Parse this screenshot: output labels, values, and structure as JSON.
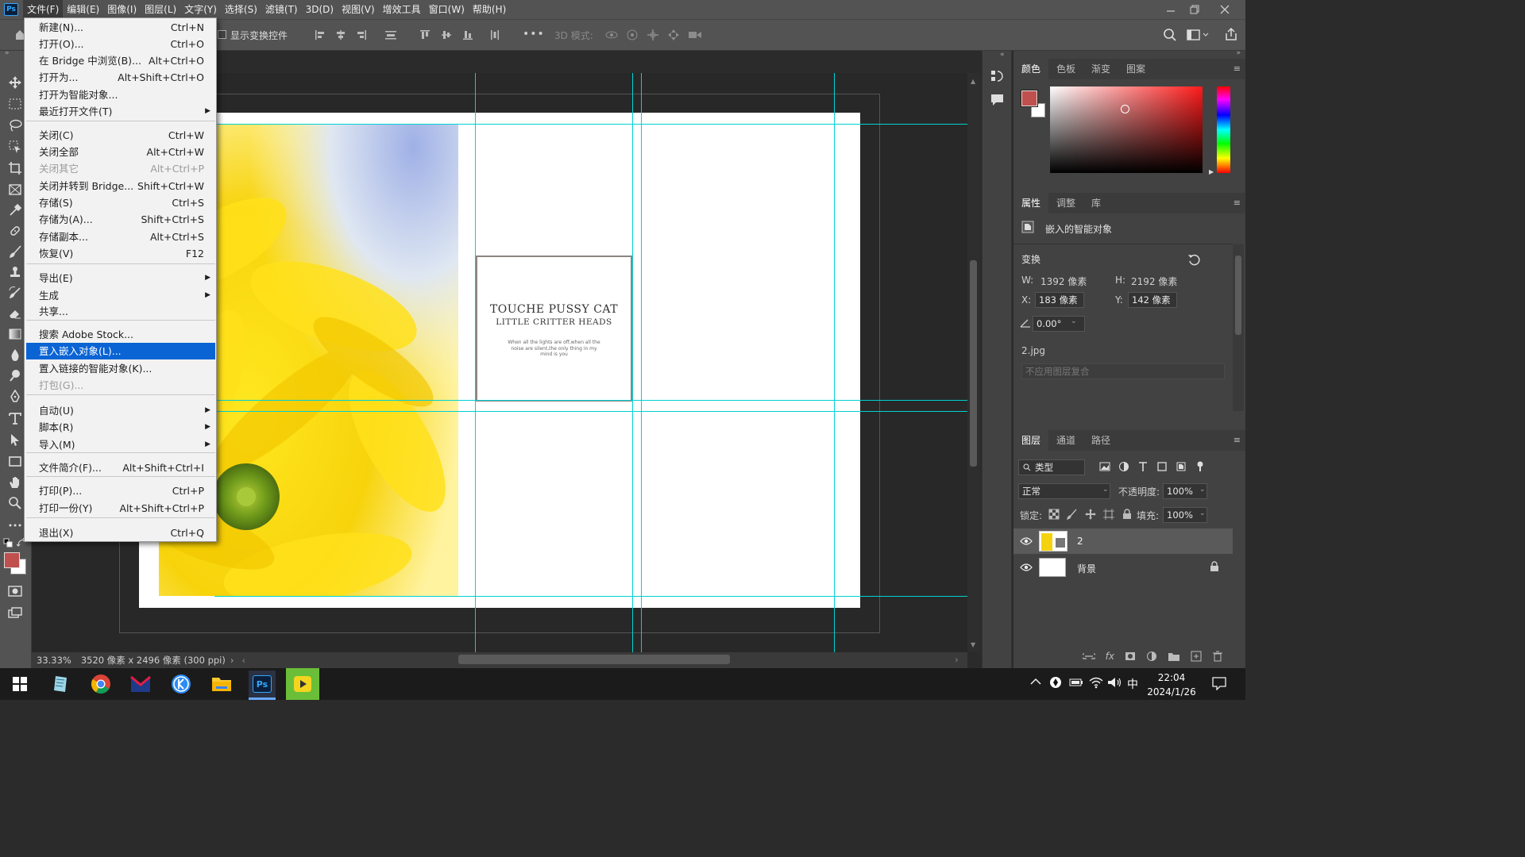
{
  "app": {
    "logo_text": "Ps"
  },
  "menubar": {
    "items": [
      "文件(F)",
      "编辑(E)",
      "图像(I)",
      "图层(L)",
      "文字(Y)",
      "选择(S)",
      "滤镜(T)",
      "3D(D)",
      "视图(V)",
      "增效工具",
      "窗口(W)",
      "帮助(H)"
    ],
    "active_index": 0
  },
  "options_bar": {
    "show_transform_label": "显示变换控件",
    "mode_3d_label": "3D 模式:"
  },
  "file_menu": {
    "items": [
      {
        "label": "新建(N)...",
        "shortcut": "Ctrl+N"
      },
      {
        "label": "打开(O)...",
        "shortcut": "Ctrl+O"
      },
      {
        "label": "在 Bridge 中浏览(B)...",
        "shortcut": "Alt+Ctrl+O"
      },
      {
        "label": "打开为...",
        "shortcut": "Alt+Shift+Ctrl+O"
      },
      {
        "label": "打开为智能对象...",
        "shortcut": ""
      },
      {
        "label": "最近打开文件(T)",
        "shortcut": "",
        "submenu": true
      },
      {
        "label": "关闭(C)",
        "shortcut": "Ctrl+W"
      },
      {
        "label": "关闭全部",
        "shortcut": "Alt+Ctrl+W"
      },
      {
        "label": "关闭其它",
        "shortcut": "Alt+Ctrl+P",
        "disabled": true
      },
      {
        "label": "关闭并转到 Bridge...",
        "shortcut": "Shift+Ctrl+W"
      },
      {
        "label": "存储(S)",
        "shortcut": "Ctrl+S"
      },
      {
        "label": "存储为(A)...",
        "shortcut": "Shift+Ctrl+S"
      },
      {
        "label": "存储副本...",
        "shortcut": "Alt+Ctrl+S"
      },
      {
        "label": "恢复(V)",
        "shortcut": "F12"
      },
      {
        "label": "导出(E)",
        "shortcut": "",
        "submenu": true
      },
      {
        "label": "生成",
        "shortcut": "",
        "submenu": true
      },
      {
        "label": "共享...",
        "shortcut": ""
      },
      {
        "label": "搜索 Adobe Stock...",
        "shortcut": ""
      },
      {
        "label": "置入嵌入对象(L)...",
        "shortcut": "",
        "highlighted": true
      },
      {
        "label": "置入链接的智能对象(K)...",
        "shortcut": ""
      },
      {
        "label": "打包(G)...",
        "shortcut": "",
        "disabled": true
      },
      {
        "label": "自动(U)",
        "shortcut": "",
        "submenu": true
      },
      {
        "label": "脚本(R)",
        "shortcut": "",
        "submenu": true
      },
      {
        "label": "导入(M)",
        "shortcut": "",
        "submenu": true
      },
      {
        "label": "文件简介(F)...",
        "shortcut": "Alt+Shift+Ctrl+I"
      },
      {
        "label": "打印(P)...",
        "shortcut": "Ctrl+P"
      },
      {
        "label": "打印一份(Y)",
        "shortcut": "Alt+Shift+Ctrl+P"
      },
      {
        "label": "退出(X)",
        "shortcut": "Ctrl+Q"
      }
    ]
  },
  "canvas": {
    "card_title": "TOUCHE PUSSY CAT",
    "card_subtitle": "LITTLE CRITTER HEADS",
    "card_body": "When all the lights are off,when all the noise are silent,the only thing in my mind is you"
  },
  "status": {
    "zoom": "33.33%",
    "doc_info": "3520 像素 x 2496 像素 (300 ppi)"
  },
  "color_panel": {
    "tabs": [
      "颜色",
      "色板",
      "渐变",
      "图案"
    ],
    "active": 0,
    "foreground": "#c0504d",
    "background": "#ffffff"
  },
  "properties_panel": {
    "tabs": [
      "属性",
      "调整",
      "库"
    ],
    "active": 0,
    "object_type": "嵌入的智能对象",
    "transform_label": "变换",
    "w_label": "W:",
    "w_value": "1392 像素",
    "h_label": "H:",
    "h_value": "2192 像素",
    "x_label": "X:",
    "x_value": "183 像素",
    "y_label": "Y:",
    "y_value": "142 像素",
    "angle_value": "0.00°",
    "file_name": "2.jpg",
    "comp_placeholder": "不应用图层复合"
  },
  "layers_panel": {
    "tabs": [
      "图层",
      "通道",
      "路径"
    ],
    "active": 0,
    "filter_label": "类型",
    "blend_mode": "正常",
    "opacity_label": "不透明度:",
    "opacity_value": "100%",
    "lock_label": "锁定:",
    "fill_label": "填充:",
    "fill_value": "100%",
    "layers": [
      {
        "name": "2",
        "selected": true
      },
      {
        "name": "背景",
        "locked": true
      }
    ]
  },
  "taskbar": {
    "time": "22:04",
    "date": "2024/1/26",
    "ime": "中"
  },
  "colors": {
    "highlight": "#0a64d4",
    "guide": "#00d2d2",
    "ps_blue": "#31a8ff"
  }
}
